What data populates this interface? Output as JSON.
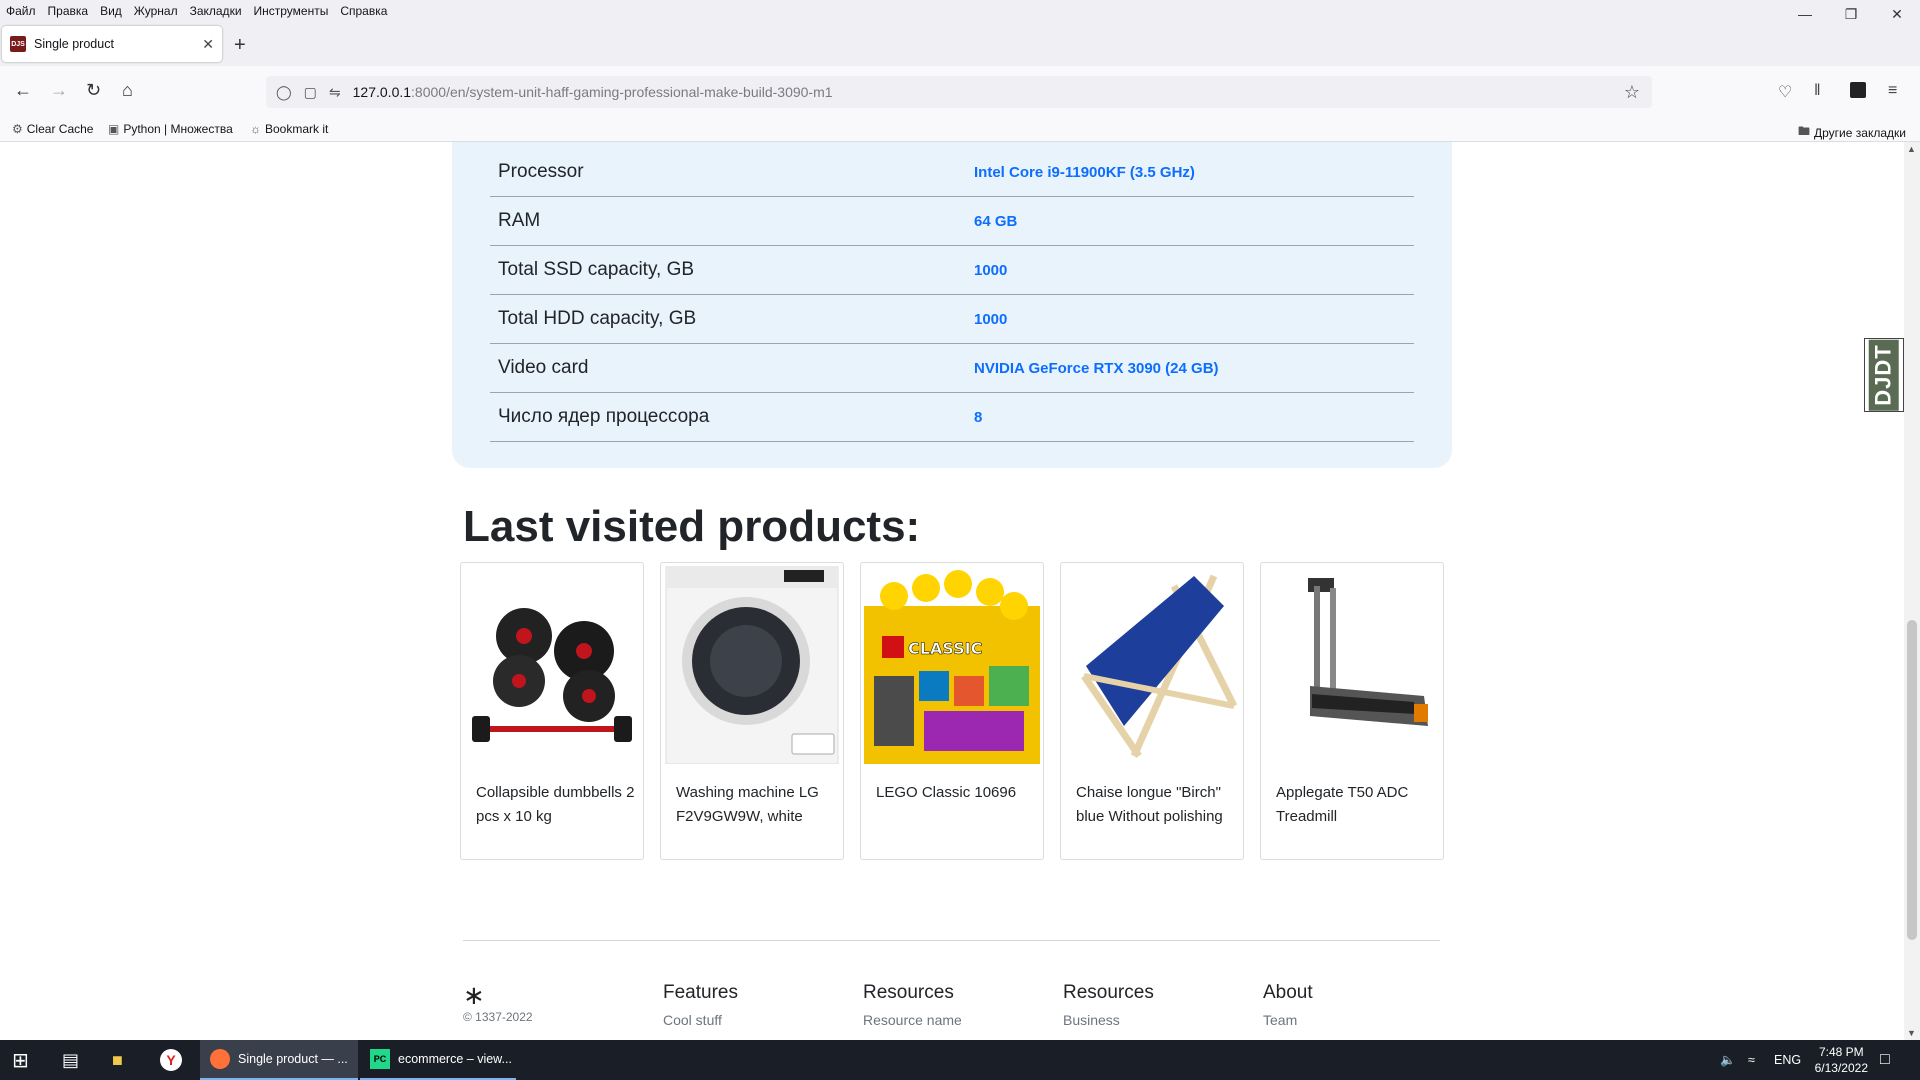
{
  "menu": [
    "Файл",
    "Правка",
    "Вид",
    "Журнал",
    "Закладки",
    "Инструменты",
    "Справка"
  ],
  "tab": {
    "title": "Single product",
    "favicon_text": "DJS"
  },
  "url": {
    "host": "127.0.0.1",
    "path": ":8000/en/system-unit-haff-gaming-professional-make-build-3090-m1"
  },
  "bookmarks": {
    "items": [
      "Clear Cache",
      "Python | Множества",
      "Bookmark it"
    ],
    "other": "Другие закладки"
  },
  "specs": [
    {
      "key": "Processor",
      "value": "Intel Core i9-11900KF (3.5 GHz)"
    },
    {
      "key": "RAM",
      "value": "64 GB"
    },
    {
      "key": "Total SSD capacity, GB",
      "value": "1000"
    },
    {
      "key": "Total HDD capacity, GB",
      "value": "1000"
    },
    {
      "key": "Video card",
      "value": "NVIDIA GeForce RTX 3090 (24 GB)"
    },
    {
      "key": "Число ядер процессора",
      "value": "8"
    }
  ],
  "last_visited": {
    "title": "Last visited products:",
    "products": [
      "Collapsible dumbbells 2 pcs x 10 kg",
      "Washing machine LG F2V9GW9W, white",
      "LEGO Classic 10696",
      "Chaise longue \"Birch\" blue Without polishing",
      "Applegate T50 ADC Treadmill"
    ]
  },
  "footer": {
    "logo": "∗",
    "copyright": "© 1337-2022",
    "columns": [
      {
        "heading": "Features",
        "link": "Cool stuff"
      },
      {
        "heading": "Resources",
        "link": "Resource name"
      },
      {
        "heading": "Resources",
        "link": "Business"
      },
      {
        "heading": "About",
        "link": "Team"
      }
    ]
  },
  "djdt": "DJDT",
  "taskbar": {
    "apps": [
      "Single product — ...",
      "ecommerce – view..."
    ],
    "lang": "ENG",
    "time": "7:48 PM",
    "date": "6/13/2022"
  },
  "colors": {
    "link": "#0d6efd",
    "spec_bg": "#e9f3fc",
    "taskbar": "#1a1f27"
  }
}
